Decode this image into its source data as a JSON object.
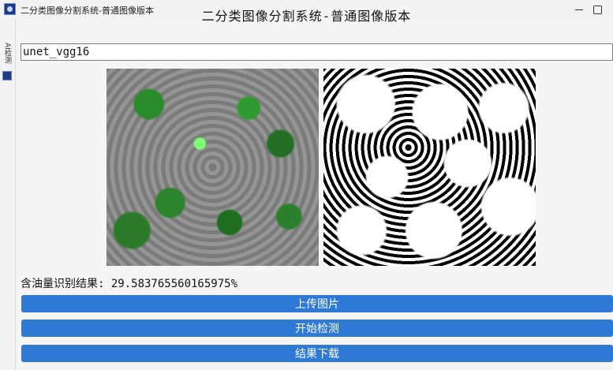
{
  "window": {
    "title": "二分类图像分割系统-普通图像版本",
    "controls": [
      "minimize",
      "maximize"
    ]
  },
  "sidebar": {
    "tab_label": "AI检测"
  },
  "main": {
    "heading": "二分类图像分割系统-普通图像版本",
    "model_name": "unet_vgg16",
    "result_label": "含油量识别结果: 29.583765560165975%"
  },
  "buttons": {
    "upload": "上传图片",
    "start": "开始检测",
    "download": "结果下载"
  },
  "colors": {
    "button_blue": "#2f79d6",
    "window_bg": "#f3f3f3"
  }
}
